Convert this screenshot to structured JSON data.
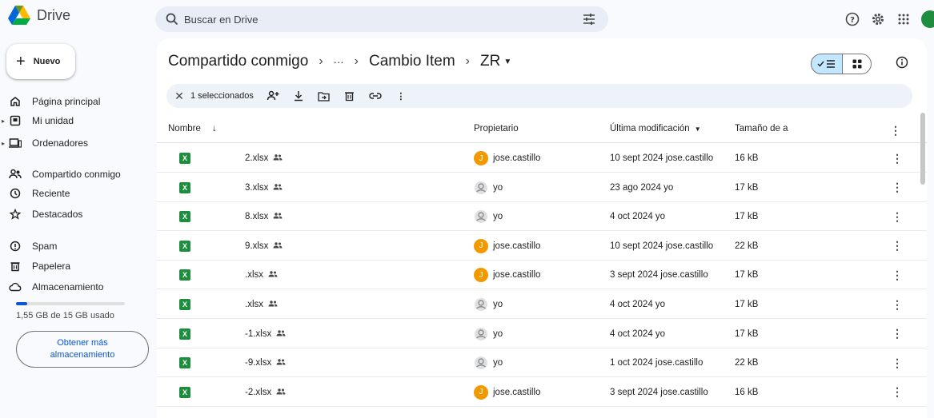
{
  "app": {
    "title": "Drive"
  },
  "search": {
    "placeholder": "Buscar en Drive"
  },
  "sidebar": {
    "new_label": "Nuevo",
    "items": [
      {
        "label": "Página principal",
        "icon": "home-icon",
        "expandable": false
      },
      {
        "label": "Mi unidad",
        "icon": "my-drive-icon",
        "expandable": true
      },
      {
        "label": "Ordenadores",
        "icon": "computer-icon",
        "expandable": true
      },
      {
        "label": "Compartido conmigo",
        "icon": "shared-with-me-icon",
        "expandable": false
      },
      {
        "label": "Reciente",
        "icon": "clock-icon",
        "expandable": false
      },
      {
        "label": "Destacados",
        "icon": "star-icon",
        "expandable": false
      },
      {
        "label": "Spam",
        "icon": "spam-icon",
        "expandable": false
      },
      {
        "label": "Papelera",
        "icon": "trash-icon",
        "expandable": false
      },
      {
        "label": "Almacenamiento",
        "icon": "cloud-icon",
        "expandable": false
      }
    ],
    "storage_used_fraction": 0.1,
    "storage_text": "1,55 GB de 15 GB usado",
    "get_storage_label": "Obtener más almacenamiento"
  },
  "breadcrumb": {
    "items": [
      "Compartido conmigo",
      "···",
      "Cambio Item"
    ],
    "current": "ZR"
  },
  "selection": {
    "count_label": "1 seleccionados"
  },
  "table": {
    "columns": [
      "Nombre",
      "Propietario",
      "Última modificación",
      "Tamaño de a"
    ],
    "rows": [
      {
        "name": "2.xlsx",
        "owner": "jose.castillo",
        "owner_type": "j",
        "modified": "10 sept 2024 jose.castillo",
        "size": "16 kB"
      },
      {
        "name": "3.xlsx",
        "owner": "yo",
        "owner_type": "y",
        "modified": "23 ago 2024 yo",
        "size": "17 kB"
      },
      {
        "name": "8.xlsx",
        "owner": "yo",
        "owner_type": "y",
        "modified": "4 oct 2024 yo",
        "size": "17 kB"
      },
      {
        "name": "9.xlsx",
        "owner": "jose.castillo",
        "owner_type": "j",
        "modified": "10 sept 2024 jose.castillo",
        "size": "22 kB"
      },
      {
        "name": ".xlsx",
        "owner": "jose.castillo",
        "owner_type": "j",
        "modified": "3 sept 2024 jose.castillo",
        "size": "17 kB"
      },
      {
        "name": ".xlsx",
        "owner": "yo",
        "owner_type": "y",
        "modified": "4 oct 2024 yo",
        "size": "17 kB"
      },
      {
        "name": "-1.xlsx",
        "owner": "yo",
        "owner_type": "y",
        "modified": "4 oct 2024 yo",
        "size": "17 kB"
      },
      {
        "name": "-9.xlsx",
        "owner": "yo",
        "owner_type": "y",
        "modified": "1 oct 2024 jose.castillo",
        "size": "22 kB"
      },
      {
        "name": "-2.xlsx",
        "owner": "jose.castillo",
        "owner_type": "j",
        "modified": "3 sept 2024 jose.castillo",
        "size": "16 kB"
      }
    ]
  },
  "colors": {
    "accent": "#0b57d0",
    "selected_toggle": "#c2e7ff",
    "excel_green": "#1e8e3e",
    "owner_avatar": "#f29900"
  }
}
